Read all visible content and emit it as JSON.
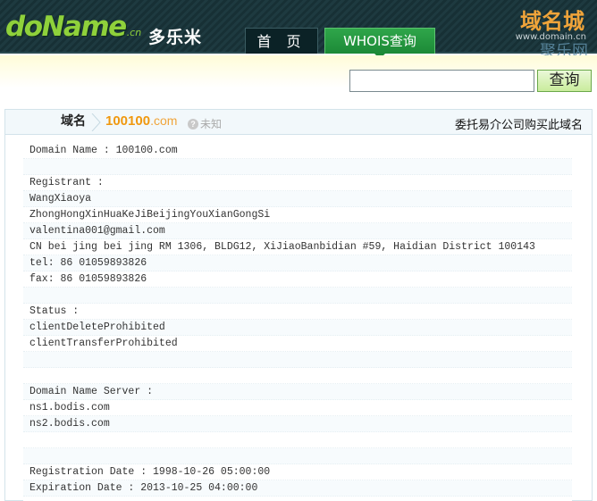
{
  "header": {
    "logo_text": "doName",
    "logo_suffix": ".cn",
    "brand": "多乐米",
    "nav": {
      "home": "首 页",
      "whois": "WHOIS查询"
    },
    "watermark": {
      "top": "域名城",
      "url": "www.domain.cn",
      "bottom": "聚乐网"
    }
  },
  "search": {
    "value": "",
    "placeholder": "",
    "button_label": "查询"
  },
  "result": {
    "label": "域名",
    "domain_sld": "100100",
    "domain_tld": ".com",
    "status": "未知",
    "buy_link": "委托易介公司购买此域名",
    "lines": [
      "Domain Name : 100100.com",
      "",
      "Registrant :",
      "WangXiaoya",
      "ZhongHongXinHuaKeJiBeijingYouXianGongSi",
      "valentina001@gmail.com",
      "CN bei jing bei jing RM 1306, BLDG12, XiJiaoBanbidian #59, Haidian District 100143",
      "tel: 86 01059893826",
      "fax: 86 01059893826",
      "",
      "Status :",
      "clientDeleteProhibited",
      "clientTransferProhibited",
      "",
      "",
      "Domain Name Server :",
      "ns1.bodis.com",
      "ns2.bodis.com",
      "",
      "",
      "Registration Date : 1998-10-26 05:00:00",
      "Expiration Date : 2013-10-25 04:00:00",
      ""
    ]
  },
  "colors": {
    "header_bg": "#1e3a40",
    "logo_green": "#8fd13b",
    "tab_active": "#1c8a37",
    "domain_orange": "#f0980f",
    "search_strip": "#fffcd8"
  }
}
